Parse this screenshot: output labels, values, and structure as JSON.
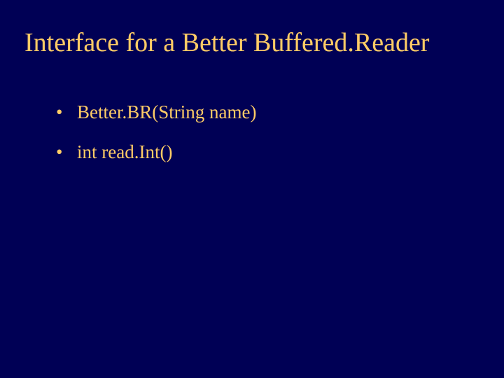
{
  "title": "Interface for a Better Buffered.Reader",
  "bullets": [
    "Better.BR(String name)",
    "int read.Int()"
  ]
}
